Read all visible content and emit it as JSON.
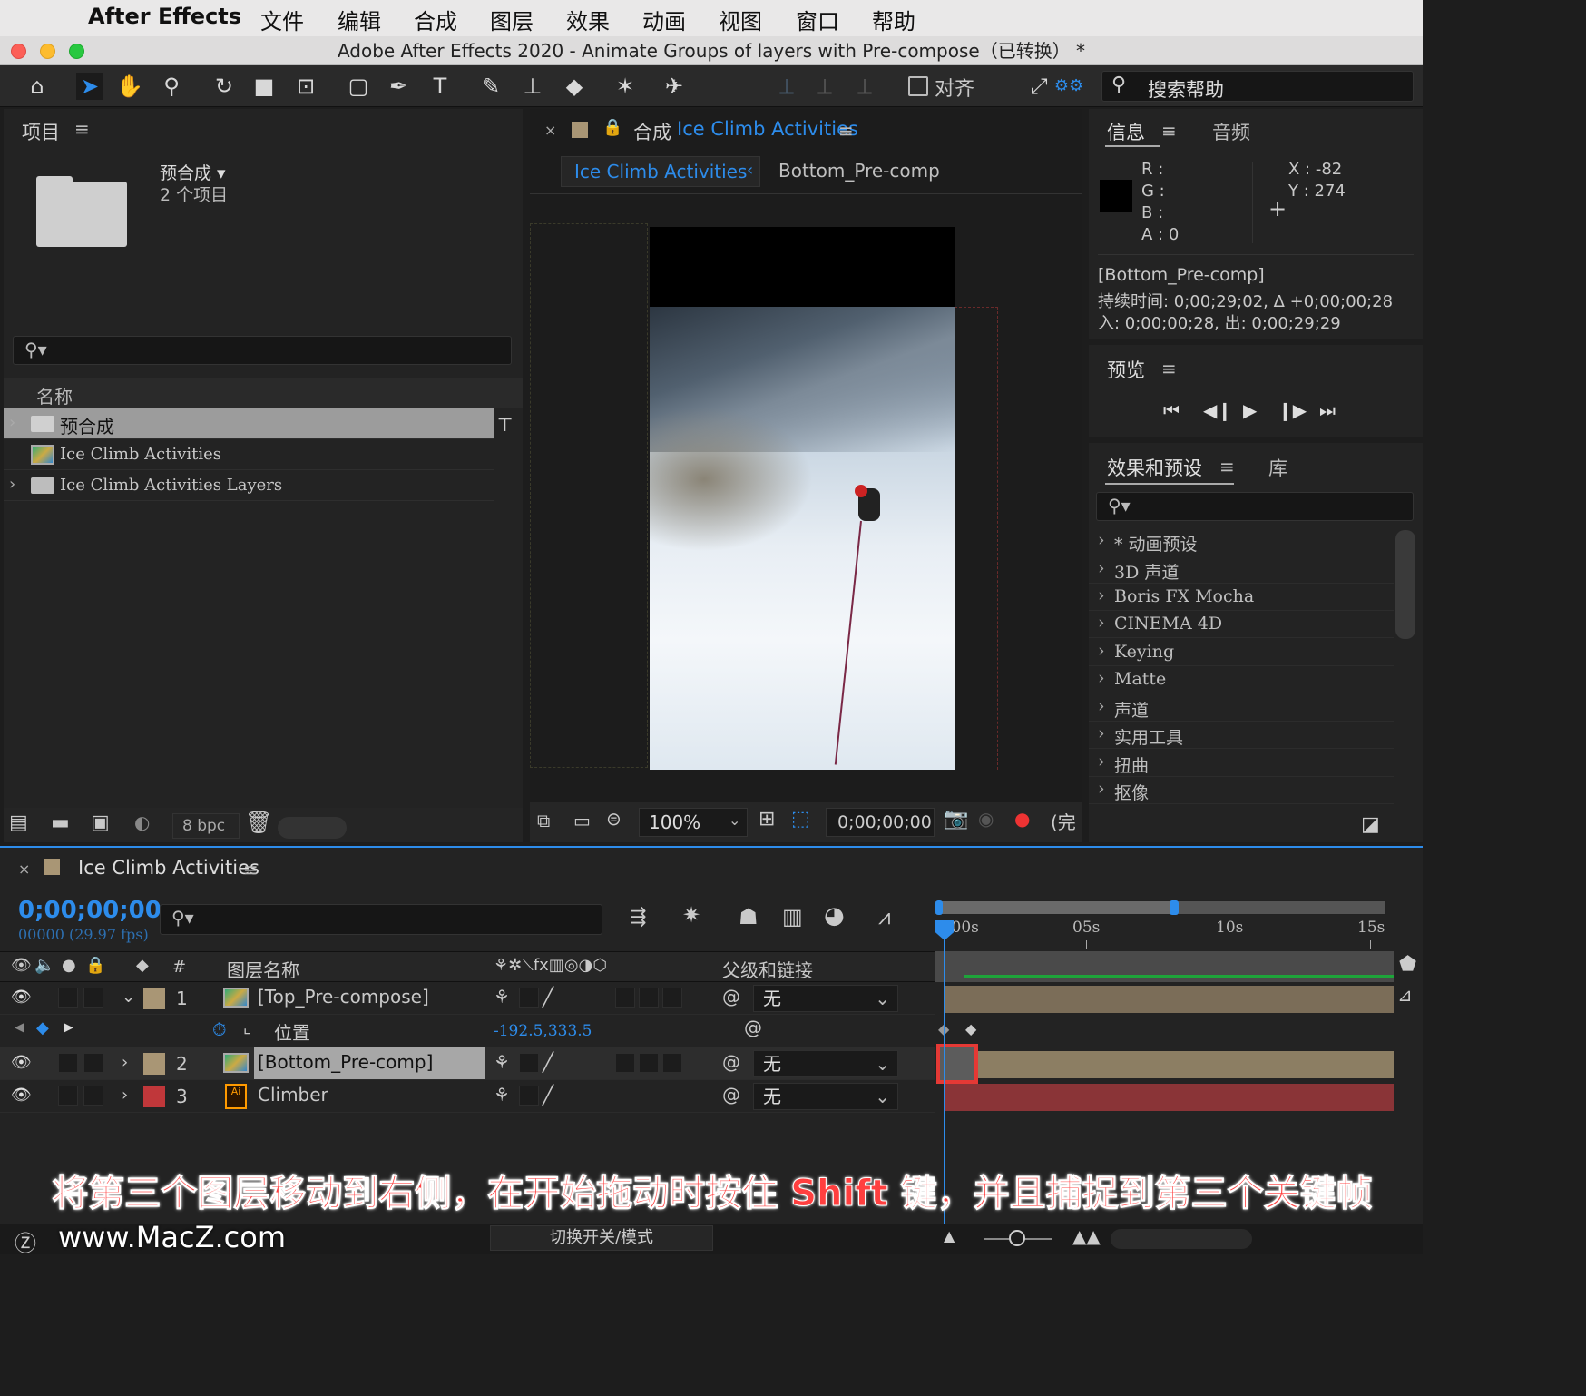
{
  "menubar": {
    "app": "After Effects",
    "items": [
      "文件",
      "编辑",
      "合成",
      "图层",
      "效果",
      "动画",
      "视图",
      "窗口",
      "帮助"
    ]
  },
  "window": {
    "title": "Adobe After Effects 2020 - Animate Groups of layers with Pre-compose（已转换） *"
  },
  "toolbar": {
    "align_label": "对齐",
    "search_help": "搜索帮助"
  },
  "project": {
    "title": "项目",
    "selected_name": "预合成 ▾",
    "selected_info": "2 个项目",
    "column_name": "名称",
    "items": [
      {
        "name": "预合成",
        "icon": "folder-icon"
      },
      {
        "name": "Ice Climb Activities",
        "icon": "composition-icon"
      },
      {
        "name": "Ice Climb Activities Layers",
        "icon": "folder-icon"
      }
    ],
    "bpc": "8 bpc"
  },
  "composition": {
    "prefix": "合成",
    "name": "Ice Climb Activities",
    "tab_active": "Ice Climb Activities",
    "tab_next": "Bottom_Pre-comp",
    "zoom": "100%",
    "timecode": "0;00;00;00",
    "quality": "(完"
  },
  "info": {
    "tab_info": "信息",
    "tab_audio": "音频",
    "r": "R :",
    "g": "G :",
    "b": "B :",
    "a": "A :  0",
    "x": "X : -82",
    "y": "Y :  274",
    "layer": "[Bottom_Pre-comp]",
    "duration": "持续时间: 0;00;29;02, Δ +0;00;00;28",
    "inout": "入: 0;00;00;28,   出: 0;00;29;29"
  },
  "preview": {
    "title": "预览"
  },
  "effects": {
    "tab_effects": "效果和预设",
    "tab_library": "库",
    "items": [
      "* 动画预设",
      "3D 声道",
      "Boris FX Mocha",
      "CINEMA 4D",
      "Keying",
      "Matte",
      "声道",
      "实用工具",
      "扭曲",
      "抠像"
    ]
  },
  "timeline": {
    "comp_name": "Ice Climb Activities",
    "timecode": "0;00;00;00",
    "fps": "00000 (29.97 fps)",
    "col_hash": "#",
    "col_layer_name": "图层名称",
    "col_parent": "父级和链接",
    "ruler": [
      "0:00s",
      "05s",
      "10s",
      "15s"
    ],
    "layers": [
      {
        "num": "1",
        "name": "[Top_Pre-compose]",
        "parent": "无",
        "color": "#a99675"
      },
      {
        "num": "2",
        "name": "[Bottom_Pre-comp]",
        "parent": "无",
        "color": "#a99675"
      },
      {
        "num": "3",
        "name": "Climber",
        "parent": "无",
        "color": "#c0373a"
      }
    ],
    "property_name": "位置",
    "property_value": "-192.5,333.5",
    "footer_mode": "切换开关/模式"
  },
  "caption": "将第三个图层移动到右侧，在开始拖动时按住 Shift 键，并且捕捉到第三个关键帧",
  "watermark": "www.MacZ.com",
  "colors": {
    "accent_blue": "#2d8ceb",
    "highlight_red": "#e53935",
    "layer_tan": "#a99675",
    "layer_red": "#c0373a"
  }
}
